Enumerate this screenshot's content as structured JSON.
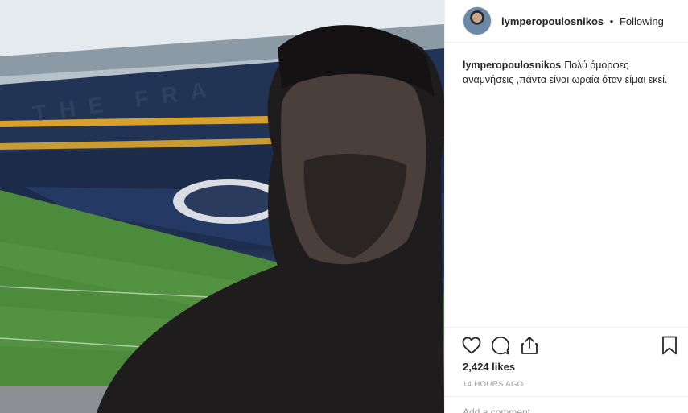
{
  "post": {
    "username": "lymperopoulosnikos",
    "separator": "•",
    "follow_status": "Following",
    "caption": "Πολύ όμορφες αναμνήσεις ,πάντα είναι ωραία όταν είμαι εκεί.",
    "likes": "2,424 likes",
    "timestamp": "14 HOURS AGO",
    "add_comment_placeholder": "Add a comment..."
  },
  "stadium_banner_text": "THE FRA",
  "icons": [
    "heart-icon",
    "comment-icon",
    "share-icon",
    "bookmark-icon"
  ],
  "colors": {
    "pitch": "#4c8b3b",
    "seats": "#1d2d4e",
    "text": "#262626",
    "muted": "#999999"
  }
}
